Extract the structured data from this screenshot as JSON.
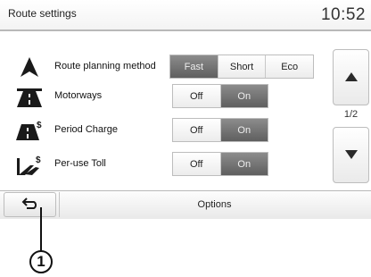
{
  "header": {
    "title": "Route settings",
    "clock": "10:52"
  },
  "settings": [
    {
      "label": "Route planning method",
      "icon": "navigation-arrow-icon",
      "options": [
        "Fast",
        "Short",
        "Eco"
      ],
      "selected": 0
    },
    {
      "label": "Motorways",
      "icon": "motorway-icon",
      "options": [
        "Off",
        "On"
      ],
      "selected": 1
    },
    {
      "label": "Period Charge",
      "icon": "period-charge-icon",
      "options": [
        "Off",
        "On"
      ],
      "selected": 1
    },
    {
      "label": "Per-use Toll",
      "icon": "toll-road-icon",
      "options": [
        "Off",
        "On"
      ],
      "selected": 1
    }
  ],
  "pagination": {
    "indicator": "1/2",
    "up_icon": "arrow-up-icon",
    "down_icon": "arrow-down-icon"
  },
  "bottom_bar": {
    "back_icon": "back-arrow-icon",
    "options_label": "Options"
  },
  "callout": {
    "number": "1"
  },
  "colors": {
    "selected_bg": "#6f6f6f",
    "button_bg": "#f2f2f2",
    "border": "#bdbdbd"
  }
}
